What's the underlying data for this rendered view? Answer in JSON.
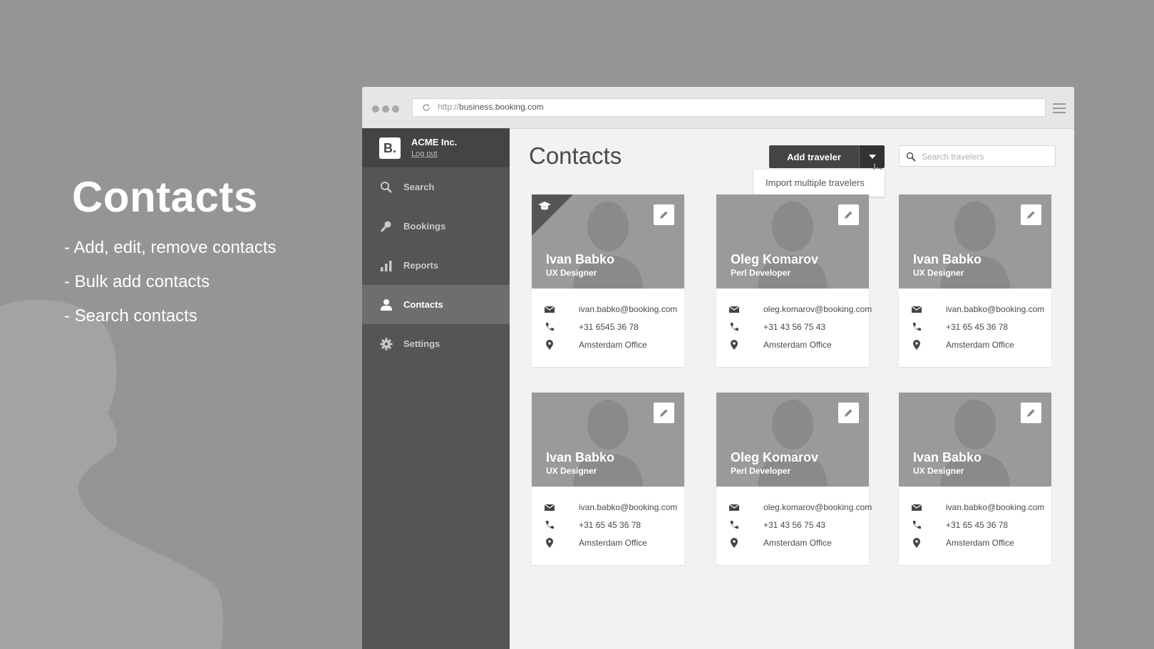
{
  "slide": {
    "headline": "Contacts",
    "bullets": [
      "- Add, edit, remove contacts",
      "- Bulk add contacts",
      "- Search contacts"
    ]
  },
  "browser": {
    "url_protocol": "http://",
    "url_host": "business.booking.com"
  },
  "sidebar": {
    "logo": "B.",
    "company": "ACME Inc.",
    "logout": "Log out",
    "items": [
      {
        "label": "Search",
        "icon": "search-icon"
      },
      {
        "label": "Bookings",
        "icon": "key-icon"
      },
      {
        "label": "Reports",
        "icon": "bar-chart-icon"
      },
      {
        "label": "Contacts",
        "icon": "user-icon",
        "active": true
      },
      {
        "label": "Settings",
        "icon": "gear-icon"
      }
    ]
  },
  "main": {
    "title": "Contacts",
    "add_button": "Add traveler",
    "dropdown_item": "Import multiple travelers",
    "search_placeholder": "Search travelers"
  },
  "contacts": [
    {
      "name": "Ivan Babko",
      "role": "UX Designer",
      "email": "ivan.babko@booking.com",
      "phone": "+31 6545 36 78",
      "office": "Amsterdam Office",
      "badge": true
    },
    {
      "name": "Oleg Komarov",
      "role": "Perl Developer",
      "email": "oleg.komarov@booking.com",
      "phone": "+31 43 56 75 43",
      "office": "Amsterdam Office"
    },
    {
      "name": "Ivan Babko",
      "role": "UX Designer",
      "email": "ivan.babko@booking.com",
      "phone": "+31 65 45 36 78",
      "office": "Amsterdam Office"
    },
    {
      "name": "Ivan Babko",
      "role": "UX Designer",
      "email": "ivan.babko@booking.com",
      "phone": "+31 65 45 36 78",
      "office": "Amsterdam Office"
    },
    {
      "name": "Oleg Komarov",
      "role": "Perl Developer",
      "email": "oleg.komarov@booking.com",
      "phone": "+31 43 56 75 43",
      "office": "Amsterdam Office"
    },
    {
      "name": "Ivan Babko",
      "role": "UX Designer",
      "email": "ivan.babko@booking.com",
      "phone": "+31 65 45 36 78",
      "office": "Amsterdam Office"
    }
  ]
}
